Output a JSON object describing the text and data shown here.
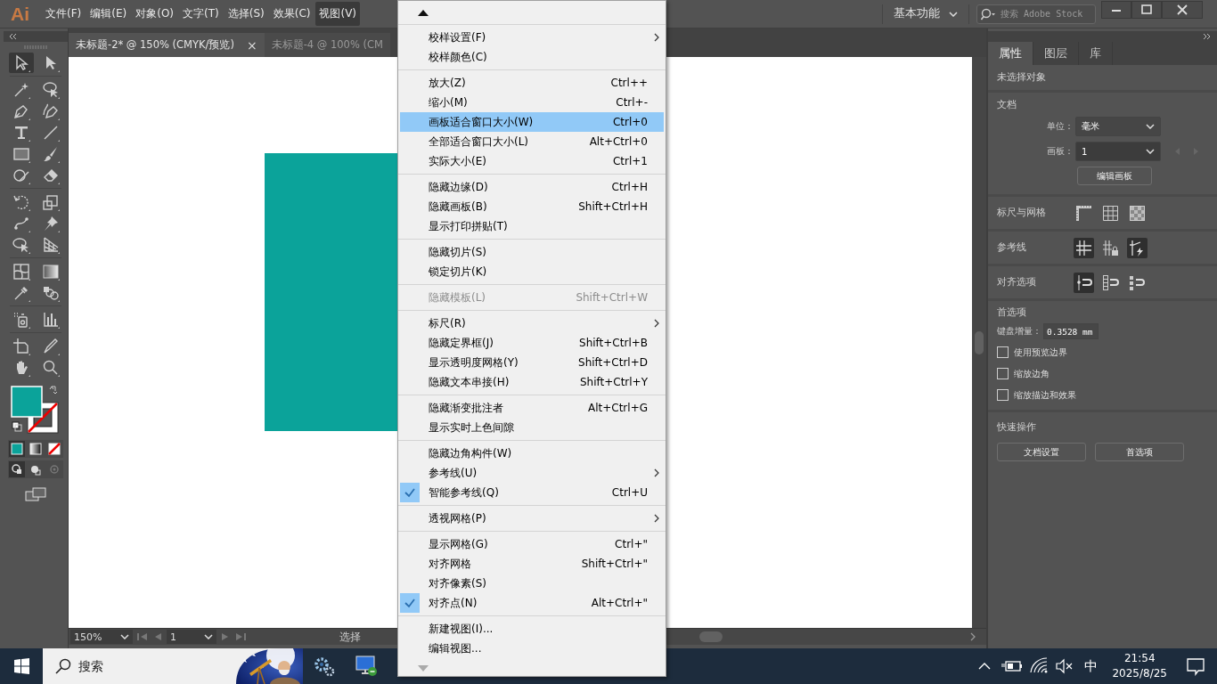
{
  "app": {
    "logo": "Ai"
  },
  "menubar": [
    {
      "label": "文件(F)",
      "selected": false
    },
    {
      "label": "编辑(E)",
      "selected": false
    },
    {
      "label": "对象(O)",
      "selected": false
    },
    {
      "label": "文字(T)",
      "selected": false
    },
    {
      "label": "选择(S)",
      "selected": false
    },
    {
      "label": "效果(C)",
      "selected": false
    },
    {
      "label": "视图(V)",
      "selected": true
    }
  ],
  "workspace": {
    "label": "基本功能"
  },
  "stock_search": {
    "placeholder": "搜索 Adobe Stock"
  },
  "doc_tabs": [
    {
      "label": "未标题-2* @ 150% (CMYK/预览)",
      "selected": true,
      "close": "×"
    },
    {
      "label": "未标题-4 @ 100% (CM",
      "selected": false
    }
  ],
  "tools": [
    {
      "kind": "selection",
      "selected": true
    },
    {
      "kind": "direct",
      "selected": false
    },
    {
      "kind": "wand",
      "selected": false
    },
    {
      "kind": "lasso",
      "selected": false
    },
    {
      "kind": "pen",
      "selected": false
    },
    {
      "kind": "curvature",
      "selected": false
    },
    {
      "kind": "type",
      "selected": false
    },
    {
      "kind": "line",
      "selected": false
    },
    {
      "kind": "rectangle",
      "selected": false
    },
    {
      "kind": "brush",
      "selected": false
    },
    {
      "kind": "shaper",
      "selected": false
    },
    {
      "kind": "eraser",
      "selected": false
    },
    {
      "kind": "rotate",
      "selected": false
    },
    {
      "kind": "scale",
      "selected": false
    },
    {
      "kind": "warp",
      "selected": false
    },
    {
      "kind": "pin",
      "selected": false
    },
    {
      "kind": "builder",
      "selected": false
    },
    {
      "kind": "perspective",
      "selected": false
    },
    {
      "kind": "mesh",
      "selected": false
    },
    {
      "kind": "gradient",
      "selected": false
    },
    {
      "kind": "eyedropper",
      "selected": false
    },
    {
      "kind": "blend",
      "selected": false
    },
    {
      "kind": "spray",
      "selected": false
    },
    {
      "kind": "chart",
      "selected": false
    },
    {
      "kind": "artboard",
      "selected": false
    },
    {
      "kind": "knife",
      "selected": false
    },
    {
      "kind": "hand",
      "selected": false
    },
    {
      "kind": "zoom",
      "selected": false
    }
  ],
  "status_bar": {
    "zoom": "150%",
    "artboard": "1",
    "tool": "选择"
  },
  "view_menu": {
    "groups": [
      [
        {
          "label": "校样设置(F)",
          "submenu": true,
          "checked": false,
          "disabled": false,
          "selected": false
        },
        {
          "label": "校样颜色(C)",
          "submenu": false,
          "checked": false,
          "disabled": false,
          "selected": false
        }
      ],
      [
        {
          "label": "放大(Z)",
          "shortcut": "Ctrl++",
          "submenu": false,
          "checked": false,
          "disabled": false,
          "selected": false
        },
        {
          "label": "缩小(M)",
          "shortcut": "Ctrl+-",
          "submenu": false,
          "checked": false,
          "disabled": false,
          "selected": false
        },
        {
          "label": "画板适合窗口大小(W)",
          "shortcut": "Ctrl+0",
          "submenu": false,
          "checked": false,
          "disabled": false,
          "selected": true
        },
        {
          "label": "全部适合窗口大小(L)",
          "shortcut": "Alt+Ctrl+0",
          "submenu": false,
          "checked": false,
          "disabled": false,
          "selected": false
        },
        {
          "label": "实际大小(E)",
          "shortcut": "Ctrl+1",
          "submenu": false,
          "checked": false,
          "disabled": false,
          "selected": false
        }
      ],
      [
        {
          "label": "隐藏边缘(D)",
          "shortcut": "Ctrl+H",
          "submenu": false,
          "checked": false,
          "disabled": false,
          "selected": false
        },
        {
          "label": "隐藏画板(B)",
          "shortcut": "Shift+Ctrl+H",
          "submenu": false,
          "checked": false,
          "disabled": false,
          "selected": false
        },
        {
          "label": "显示打印拼贴(T)",
          "submenu": false,
          "checked": false,
          "disabled": false,
          "selected": false
        }
      ],
      [
        {
          "label": "隐藏切片(S)",
          "submenu": false,
          "checked": false,
          "disabled": false,
          "selected": false
        },
        {
          "label": "锁定切片(K)",
          "submenu": false,
          "checked": false,
          "disabled": false,
          "selected": false
        }
      ],
      [
        {
          "label": "隐藏模板(L)",
          "shortcut": "Shift+Ctrl+W",
          "submenu": false,
          "checked": false,
          "disabled": true,
          "selected": false
        }
      ],
      [
        {
          "label": "标尺(R)",
          "submenu": true,
          "checked": false,
          "disabled": false,
          "selected": false
        },
        {
          "label": "隐藏定界框(J)",
          "shortcut": "Shift+Ctrl+B",
          "submenu": false,
          "checked": false,
          "disabled": false,
          "selected": false
        },
        {
          "label": "显示透明度网格(Y)",
          "shortcut": "Shift+Ctrl+D",
          "submenu": false,
          "checked": false,
          "disabled": false,
          "selected": false
        },
        {
          "label": "隐藏文本串接(H)",
          "shortcut": "Shift+Ctrl+Y",
          "submenu": false,
          "checked": false,
          "disabled": false,
          "selected": false
        }
      ],
      [
        {
          "label": "隐藏渐变批注者",
          "shortcut": "Alt+Ctrl+G",
          "submenu": false,
          "checked": false,
          "disabled": false,
          "selected": false
        },
        {
          "label": "显示实时上色间隙",
          "submenu": false,
          "checked": false,
          "disabled": false,
          "selected": false
        }
      ],
      [
        {
          "label": "隐藏边角构件(W)",
          "submenu": false,
          "checked": false,
          "disabled": false,
          "selected": false
        },
        {
          "label": "参考线(U)",
          "submenu": true,
          "checked": false,
          "disabled": false,
          "selected": false
        },
        {
          "label": "智能参考线(Q)",
          "shortcut": "Ctrl+U",
          "submenu": false,
          "checked": true,
          "disabled": false,
          "selected": false
        }
      ],
      [
        {
          "label": "透视网格(P)",
          "submenu": true,
          "checked": false,
          "disabled": false,
          "selected": false
        }
      ],
      [
        {
          "label": "显示网格(G)",
          "shortcut": "Ctrl+\"",
          "submenu": false,
          "checked": false,
          "disabled": false,
          "selected": false
        },
        {
          "label": "对齐网格",
          "shortcut": "Shift+Ctrl+\"",
          "submenu": false,
          "checked": false,
          "disabled": false,
          "selected": false
        },
        {
          "label": "对齐像素(S)",
          "submenu": false,
          "checked": false,
          "disabled": false,
          "selected": false
        },
        {
          "label": "对齐点(N)",
          "shortcut": "Alt+Ctrl+\"",
          "submenu": false,
          "checked": true,
          "disabled": false,
          "selected": false
        }
      ],
      [
        {
          "label": "新建视图(I)...",
          "submenu": false,
          "checked": false,
          "disabled": false,
          "selected": false
        },
        {
          "label": "编辑视图...",
          "submenu": false,
          "checked": false,
          "disabled": false,
          "selected": false
        }
      ]
    ]
  },
  "properties_panel": {
    "tabs": [
      {
        "label": "属性",
        "selected": true
      },
      {
        "label": "图层",
        "selected": false
      },
      {
        "label": "库",
        "selected": false
      }
    ],
    "selection": "未选择对象",
    "document": {
      "title": "文档",
      "unit_label": "单位：",
      "unit": "毫米",
      "artboard_label": "画板：",
      "artboard": "1",
      "edit_button": "编辑画板"
    },
    "rulers": {
      "title": "标尺与网格",
      "toggles": [
        {
          "kind": "ruler",
          "on": false
        },
        {
          "kind": "grid",
          "on": false
        },
        {
          "kind": "checker",
          "on": false
        }
      ]
    },
    "guides": {
      "title": "参考线",
      "toggles": [
        {
          "kind": "guides",
          "on": true
        },
        {
          "kind": "lock",
          "on": false
        },
        {
          "kind": "smart",
          "on": true
        }
      ]
    },
    "snap": {
      "title": "对齐选项",
      "toggles": [
        {
          "kind": "point",
          "on": true
        },
        {
          "kind": "gridsnap",
          "on": false
        },
        {
          "kind": "pixel",
          "on": false
        }
      ]
    },
    "preferences": {
      "title": "首选项",
      "increment_label": "键盘增量：",
      "increment": "0.3528 mm",
      "options": [
        {
          "label": "使用预览边界",
          "checked": false
        },
        {
          "label": "缩放边角",
          "checked": false
        },
        {
          "label": "缩放描边和效果",
          "checked": false
        }
      ]
    },
    "quick_actions": {
      "title": "快速操作",
      "buttons": [
        "文档设置",
        "首选项"
      ]
    }
  },
  "taskbar": {
    "search": {
      "placeholder": "搜索"
    },
    "ime": "中",
    "time": "21:54",
    "date": "2025/8/25"
  }
}
